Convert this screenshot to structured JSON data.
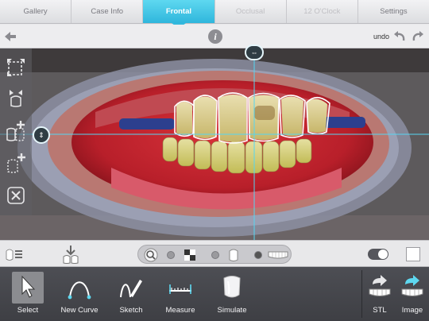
{
  "tabs": [
    {
      "label": "Gallery",
      "state": "normal"
    },
    {
      "label": "Case Info",
      "state": "normal"
    },
    {
      "label": "Frontal",
      "state": "active"
    },
    {
      "label": "Occlusal",
      "state": "disabled"
    },
    {
      "label": "12 O'Clock",
      "state": "disabled"
    },
    {
      "label": "Settings",
      "state": "normal"
    }
  ],
  "toolbar": {
    "undo_label": "undo",
    "info_label": "i"
  },
  "tools": [
    {
      "label": "Select",
      "icon": "cursor-arrow-icon",
      "selected": true
    },
    {
      "label": "New Curve",
      "icon": "curve-icon",
      "selected": false
    },
    {
      "label": "Sketch",
      "icon": "sketch-pencil-icon",
      "selected": false
    },
    {
      "label": "Measure",
      "icon": "ruler-icon",
      "selected": false
    },
    {
      "label": "Simulate",
      "icon": "tooth-veneer-icon",
      "selected": false
    }
  ],
  "exports": [
    {
      "label": "STL",
      "icon": "export-stl-icon"
    },
    {
      "label": "Image",
      "icon": "export-image-icon"
    }
  ],
  "colors": {
    "accent": "#33b9dd",
    "guide": "#55d6f2",
    "dock": "#45464c",
    "outline": "#ffffff"
  }
}
